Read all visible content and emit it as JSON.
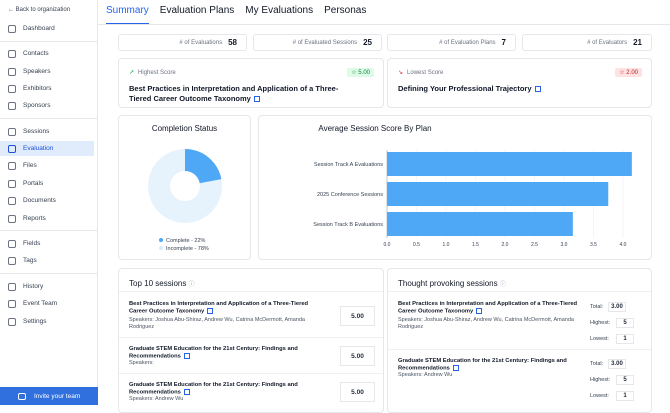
{
  "sidebar": {
    "back": "← Back to organization",
    "items": [
      {
        "label": "Dashboard",
        "icon": "dashboard-icon"
      },
      {
        "label": "Contacts",
        "icon": "user-icon"
      },
      {
        "label": "Speakers",
        "icon": "microphone-icon"
      },
      {
        "label": "Exhibitors",
        "icon": "booth-icon"
      },
      {
        "label": "Sponsors",
        "icon": "handshake-icon"
      },
      {
        "label": "Sessions",
        "icon": "calendar-icon"
      },
      {
        "label": "Evaluation",
        "icon": "chart-icon"
      },
      {
        "label": "Files",
        "icon": "file-icon"
      },
      {
        "label": "Portals",
        "icon": "portal-icon"
      },
      {
        "label": "Documents",
        "icon": "document-icon"
      },
      {
        "label": "Reports",
        "icon": "report-icon"
      },
      {
        "label": "Fields",
        "icon": "fields-icon"
      },
      {
        "label": "Tags",
        "icon": "tag-icon"
      },
      {
        "label": "History",
        "icon": "history-icon"
      },
      {
        "label": "Event Team",
        "icon": "team-icon"
      },
      {
        "label": "Settings",
        "icon": "gear-icon"
      }
    ],
    "invite": "Invite your team"
  },
  "tabs": [
    "Summary",
    "Evaluation Plans",
    "My Evaluations",
    "Personas"
  ],
  "stats": [
    {
      "label": "# of Evaluations",
      "value": "58"
    },
    {
      "label": "# of Evaluated Sessions",
      "value": "25"
    },
    {
      "label": "# of Evaluation Plans",
      "value": "7"
    },
    {
      "label": "# of Evaluators",
      "value": "21"
    }
  ],
  "highest": {
    "label": "Highest Score",
    "badge": "☆ 5.00",
    "title": "Best Practices in Interpretation and Application of a Three-Tiered Career Outcome Taxonomy"
  },
  "lowest": {
    "label": "Lowest Score",
    "badge": "☆ 2.00",
    "title": "Defining Your Professional Trajectory"
  },
  "completion": {
    "title": "Completion Status",
    "complete_label": "Complete - 22%",
    "incomplete_label": "Incomplete - 78%",
    "complete_pct": 22,
    "colors": {
      "complete": "#4ea8f5",
      "incomplete": "#e6f3fd"
    }
  },
  "chart_data": {
    "type": "bar",
    "title": "Average Session Score By Plan",
    "categories": [
      "Session Track A Evaluations",
      "2025 Conference Sessions",
      "Session Track B Evaluations"
    ],
    "values": [
      4.15,
      3.75,
      3.15
    ],
    "xlim": [
      0,
      4.0
    ],
    "ticks": [
      "0.0",
      "0.5",
      "1.0",
      "1.5",
      "2.0",
      "2.5",
      "3.0",
      "3.5",
      "4.0"
    ],
    "color": "#4ea8f5",
    "orientation": "horizontal"
  },
  "top10": {
    "title": "Top 10 sessions",
    "rows": [
      {
        "title": "Best Practices in Interpretation and Application of a Three-Tiered Career Outcome Taxonomy",
        "speakers": "Speakers: Joshua Abu-Shiraz, Andrew Wu, Catrina McDermott, Amanda Rodriguez",
        "score": "5.00"
      },
      {
        "title": "Graduate STEM Education for the 21st Century: Findings and Recommendations",
        "speakers": "Speakers:",
        "score": "5.00"
      },
      {
        "title": "Graduate STEM Education for the 21st Century: Findings and Recommendations",
        "speakers": "Speakers: Andrew Wu",
        "score": "5.00"
      }
    ]
  },
  "thought": {
    "title": "Thought provoking sessions",
    "labels": {
      "total": "Total:",
      "highest": "Highest:",
      "lowest": "Lowest:"
    },
    "rows": [
      {
        "title": "Best Practices in Interpretation and Application of a Three-Tiered Career Outcome Taxonomy",
        "speakers": "Speakers: Joshua Abu-Shiraz, Andrew Wu, Catrina McDermott, Amanda Rodriguez",
        "total": "3.00",
        "highest": "5",
        "lowest": "1"
      },
      {
        "title": "Graduate STEM Education for the 21st Century: Findings and Recommendations",
        "speakers": "Speakers: Andrew Wu",
        "total": "3.00",
        "highest": "5",
        "lowest": "1"
      }
    ]
  }
}
